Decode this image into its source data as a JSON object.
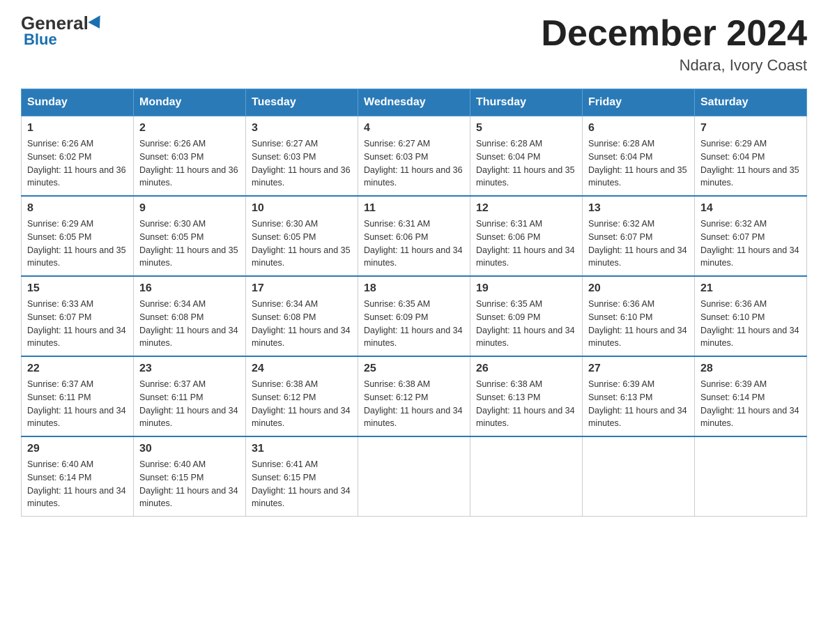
{
  "header": {
    "logo_general": "General",
    "logo_blue": "Blue",
    "month_title": "December 2024",
    "location": "Ndara, Ivory Coast"
  },
  "days_of_week": [
    "Sunday",
    "Monday",
    "Tuesday",
    "Wednesday",
    "Thursday",
    "Friday",
    "Saturday"
  ],
  "weeks": [
    [
      {
        "day": "1",
        "sunrise": "6:26 AM",
        "sunset": "6:02 PM",
        "daylight": "11 hours and 36 minutes."
      },
      {
        "day": "2",
        "sunrise": "6:26 AM",
        "sunset": "6:03 PM",
        "daylight": "11 hours and 36 minutes."
      },
      {
        "day": "3",
        "sunrise": "6:27 AM",
        "sunset": "6:03 PM",
        "daylight": "11 hours and 36 minutes."
      },
      {
        "day": "4",
        "sunrise": "6:27 AM",
        "sunset": "6:03 PM",
        "daylight": "11 hours and 36 minutes."
      },
      {
        "day": "5",
        "sunrise": "6:28 AM",
        "sunset": "6:04 PM",
        "daylight": "11 hours and 35 minutes."
      },
      {
        "day": "6",
        "sunrise": "6:28 AM",
        "sunset": "6:04 PM",
        "daylight": "11 hours and 35 minutes."
      },
      {
        "day": "7",
        "sunrise": "6:29 AM",
        "sunset": "6:04 PM",
        "daylight": "11 hours and 35 minutes."
      }
    ],
    [
      {
        "day": "8",
        "sunrise": "6:29 AM",
        "sunset": "6:05 PM",
        "daylight": "11 hours and 35 minutes."
      },
      {
        "day": "9",
        "sunrise": "6:30 AM",
        "sunset": "6:05 PM",
        "daylight": "11 hours and 35 minutes."
      },
      {
        "day": "10",
        "sunrise": "6:30 AM",
        "sunset": "6:05 PM",
        "daylight": "11 hours and 35 minutes."
      },
      {
        "day": "11",
        "sunrise": "6:31 AM",
        "sunset": "6:06 PM",
        "daylight": "11 hours and 34 minutes."
      },
      {
        "day": "12",
        "sunrise": "6:31 AM",
        "sunset": "6:06 PM",
        "daylight": "11 hours and 34 minutes."
      },
      {
        "day": "13",
        "sunrise": "6:32 AM",
        "sunset": "6:07 PM",
        "daylight": "11 hours and 34 minutes."
      },
      {
        "day": "14",
        "sunrise": "6:32 AM",
        "sunset": "6:07 PM",
        "daylight": "11 hours and 34 minutes."
      }
    ],
    [
      {
        "day": "15",
        "sunrise": "6:33 AM",
        "sunset": "6:07 PM",
        "daylight": "11 hours and 34 minutes."
      },
      {
        "day": "16",
        "sunrise": "6:34 AM",
        "sunset": "6:08 PM",
        "daylight": "11 hours and 34 minutes."
      },
      {
        "day": "17",
        "sunrise": "6:34 AM",
        "sunset": "6:08 PM",
        "daylight": "11 hours and 34 minutes."
      },
      {
        "day": "18",
        "sunrise": "6:35 AM",
        "sunset": "6:09 PM",
        "daylight": "11 hours and 34 minutes."
      },
      {
        "day": "19",
        "sunrise": "6:35 AM",
        "sunset": "6:09 PM",
        "daylight": "11 hours and 34 minutes."
      },
      {
        "day": "20",
        "sunrise": "6:36 AM",
        "sunset": "6:10 PM",
        "daylight": "11 hours and 34 minutes."
      },
      {
        "day": "21",
        "sunrise": "6:36 AM",
        "sunset": "6:10 PM",
        "daylight": "11 hours and 34 minutes."
      }
    ],
    [
      {
        "day": "22",
        "sunrise": "6:37 AM",
        "sunset": "6:11 PM",
        "daylight": "11 hours and 34 minutes."
      },
      {
        "day": "23",
        "sunrise": "6:37 AM",
        "sunset": "6:11 PM",
        "daylight": "11 hours and 34 minutes."
      },
      {
        "day": "24",
        "sunrise": "6:38 AM",
        "sunset": "6:12 PM",
        "daylight": "11 hours and 34 minutes."
      },
      {
        "day": "25",
        "sunrise": "6:38 AM",
        "sunset": "6:12 PM",
        "daylight": "11 hours and 34 minutes."
      },
      {
        "day": "26",
        "sunrise": "6:38 AM",
        "sunset": "6:13 PM",
        "daylight": "11 hours and 34 minutes."
      },
      {
        "day": "27",
        "sunrise": "6:39 AM",
        "sunset": "6:13 PM",
        "daylight": "11 hours and 34 minutes."
      },
      {
        "day": "28",
        "sunrise": "6:39 AM",
        "sunset": "6:14 PM",
        "daylight": "11 hours and 34 minutes."
      }
    ],
    [
      {
        "day": "29",
        "sunrise": "6:40 AM",
        "sunset": "6:14 PM",
        "daylight": "11 hours and 34 minutes."
      },
      {
        "day": "30",
        "sunrise": "6:40 AM",
        "sunset": "6:15 PM",
        "daylight": "11 hours and 34 minutes."
      },
      {
        "day": "31",
        "sunrise": "6:41 AM",
        "sunset": "6:15 PM",
        "daylight": "11 hours and 34 minutes."
      },
      null,
      null,
      null,
      null
    ]
  ]
}
